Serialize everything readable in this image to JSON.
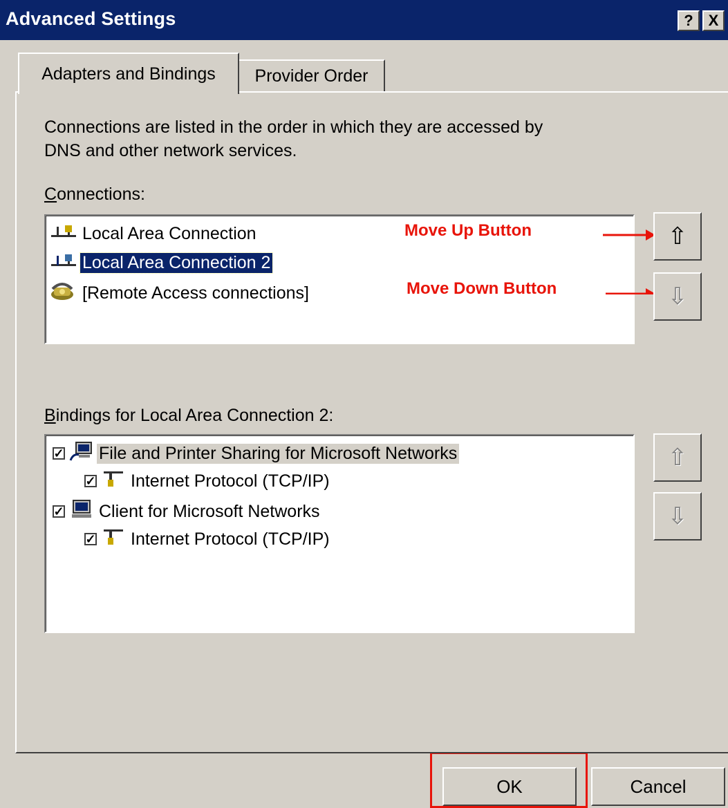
{
  "window": {
    "title": "Advanced Settings",
    "help_label": "?",
    "close_label": "X"
  },
  "tabs": [
    {
      "label": "Adapters and Bindings",
      "active": true
    },
    {
      "label": "Provider Order",
      "active": false
    }
  ],
  "description": {
    "line1": "Connections are listed in the order in which they are accessed by",
    "line2": "DNS and other network services."
  },
  "connections": {
    "label": "Connections:",
    "items": [
      {
        "label": "Local Area Connection",
        "icon": "network-icon",
        "selected": false
      },
      {
        "label": "Local Area Connection 2",
        "icon": "network-icon",
        "selected": true
      },
      {
        "label": "[Remote Access connections]",
        "icon": "phone-icon",
        "selected": false
      }
    ],
    "move_up_glyph": "⇧",
    "move_down_glyph": "⇩"
  },
  "bindings": {
    "label": "Bindings for Local Area Connection 2:",
    "items": [
      {
        "label": "File and Printer Sharing for Microsoft Networks",
        "checked": true,
        "level": 0,
        "icon": "computer-share-icon"
      },
      {
        "label": "Internet Protocol (TCP/IP)",
        "checked": true,
        "level": 1,
        "icon": "protocol-icon"
      },
      {
        "label": "Client for Microsoft Networks",
        "checked": true,
        "level": 0,
        "icon": "computer-icon"
      },
      {
        "label": "Internet Protocol (TCP/IP)",
        "checked": true,
        "level": 1,
        "icon": "protocol-icon"
      }
    ]
  },
  "annotations": {
    "move_up": "Move Up Button",
    "move_down": "Move Down Button",
    "color": "#e8140a"
  },
  "buttons": {
    "ok": "OK",
    "cancel": "Cancel"
  }
}
